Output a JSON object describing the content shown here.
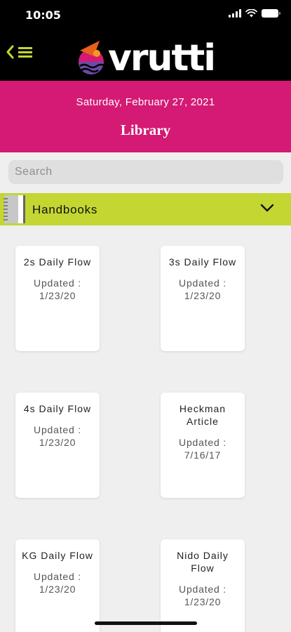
{
  "status": {
    "time": "10:05"
  },
  "header": {
    "back_icon": "chevron-left-icon",
    "menu_icon": "hamburger-menu-icon",
    "logo_text": "vrutti",
    "colors": {
      "background": "#000000",
      "accent": "#c3d632"
    }
  },
  "banner": {
    "date": "Saturday, February 27, 2021",
    "title": "Library",
    "color": "#d41a74"
  },
  "search": {
    "placeholder": "Search",
    "value": ""
  },
  "section": {
    "label": "Handbooks",
    "icon": "notebook-icon",
    "toggle_icon": "chevron-down-icon",
    "color": "#c3d632"
  },
  "cards": [
    {
      "title": "2s Daily Flow",
      "updated_label": "Updated :",
      "date": "1/23/20"
    },
    {
      "title": "3s Daily Flow",
      "updated_label": "Updated :",
      "date": "1/23/20"
    },
    {
      "title": "4s Daily Flow",
      "updated_label": "Updated :",
      "date": "1/23/20"
    },
    {
      "title": "Heckman Article",
      "updated_label": "Updated :",
      "date": "7/16/17"
    },
    {
      "title": "KG Daily Flow",
      "updated_label": "Updated :",
      "date": "1/23/20"
    },
    {
      "title": "Nido Daily Flow",
      "updated_label": "Updated :",
      "date": "1/23/20"
    }
  ]
}
